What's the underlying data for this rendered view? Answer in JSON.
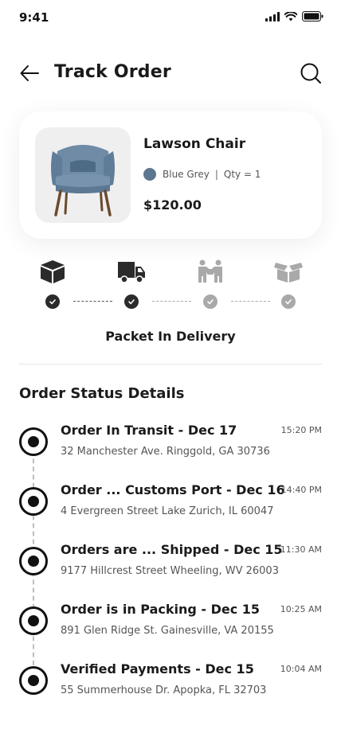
{
  "status_bar": {
    "time": "9:41"
  },
  "header": {
    "title": "Track Order"
  },
  "product": {
    "name": "Lawson Chair",
    "color_name": "Blue Grey",
    "color_hex": "#5d7690",
    "separator": "|",
    "qty": "Qty = 1",
    "price": "$120.00"
  },
  "progress": {
    "steps": [
      {
        "icon": "package-icon",
        "status": "done"
      },
      {
        "icon": "truck-icon",
        "status": "done"
      },
      {
        "icon": "delivery-people-icon",
        "status": "pending"
      },
      {
        "icon": "open-box-icon",
        "status": "pending"
      }
    ],
    "current_label": "Packet In Delivery"
  },
  "status_details": {
    "title": "Order Status Details",
    "items": [
      {
        "title": "Order In Transit - Dec 17",
        "address": "32 Manchester Ave. Ringgold, GA 30736",
        "time": "15:20 PM"
      },
      {
        "title": "Order ... Customs Port - Dec 16",
        "address": "4 Evergreen Street Lake Zurich, IL 60047",
        "time": "14:40 PM"
      },
      {
        "title": "Orders are ... Shipped - Dec 15",
        "address": "9177 Hillcrest Street Wheeling, WV 26003",
        "time": "11:30 AM"
      },
      {
        "title": "Order is in Packing - Dec 15",
        "address": "891 Glen Ridge St. Gainesville, VA 20155",
        "time": "10:25 AM"
      },
      {
        "title": "Verified Payments - Dec 15",
        "address": "55 Summerhouse Dr. Apopka, FL 32703",
        "time": "10:04 AM"
      }
    ]
  },
  "colors": {
    "done": "#2b2b2b",
    "pending": "#a9a9a9",
    "accent": "#111111"
  }
}
